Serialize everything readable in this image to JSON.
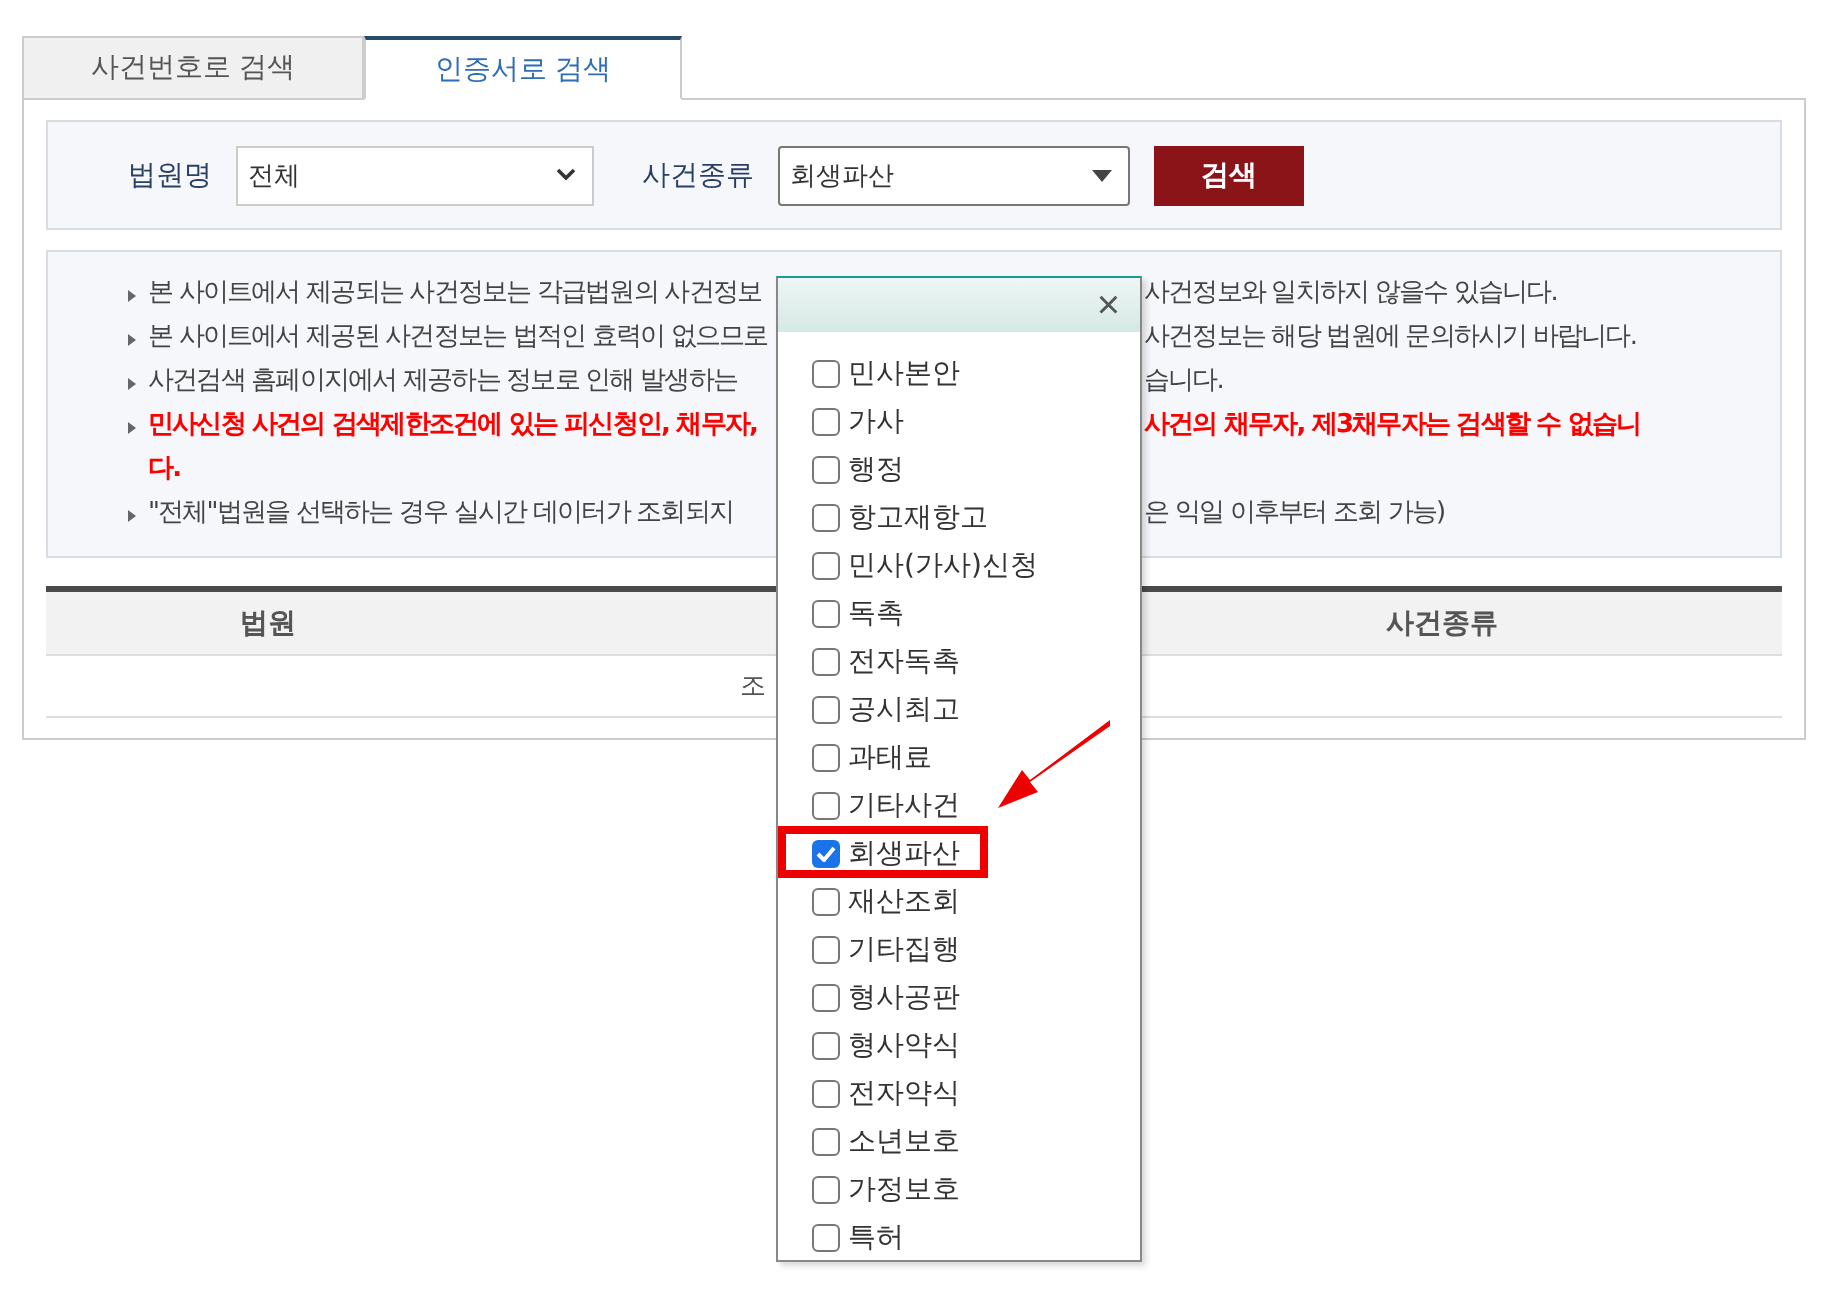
{
  "tabs": [
    {
      "label": "사건번호로 검색",
      "selected": false
    },
    {
      "label": "인증서로 검색",
      "selected": true
    }
  ],
  "search": {
    "court_label": "법원명",
    "court_value": "전체",
    "type_label": "사건종류",
    "type_value": "회생파산",
    "button": "검색"
  },
  "notices": [
    {
      "kind": "normal",
      "left": "본 사이트에서 제공되는 사건정보는 각급법원의 사건정보",
      "right": "사건정보와 일치하지 않을수 있습니다."
    },
    {
      "kind": "normal",
      "left": "본 사이트에서 제공된 사건정보는 법적인 효력이 없으므로",
      "right": "사건정보는 해당 법원에 문의하시기 바랍니다."
    },
    {
      "kind": "normal",
      "left": "사건검색 홈페이지에서 제공하는 정보로 인해 발생하는",
      "right": "습니다."
    },
    {
      "kind": "warning",
      "left": "민사신청 사건의 검색제한조건에 있는 피신청인, 채무자,",
      "right": "사건의 채무자, 제3채무자는 검색할 수 없습니",
      "tail": "다."
    },
    {
      "kind": "normal",
      "left": "\"전체\"법원을 선택하는 경우 실시간 데이터가 조회되지",
      "right": "은 익일 이후부터 조회 가능)"
    }
  ],
  "table": {
    "column_1": "법원",
    "column_3": "사건종류",
    "message": "조"
  },
  "popup": {
    "close": "×",
    "items": [
      {
        "label": "민사본안",
        "checked": false
      },
      {
        "label": "가사",
        "checked": false
      },
      {
        "label": "행정",
        "checked": false
      },
      {
        "label": "항고재항고",
        "checked": false
      },
      {
        "label": "민사(가사)신청",
        "checked": false
      },
      {
        "label": "독촉",
        "checked": false
      },
      {
        "label": "전자독촉",
        "checked": false
      },
      {
        "label": "공시최고",
        "checked": false
      },
      {
        "label": "과태료",
        "checked": false
      },
      {
        "label": "기타사건",
        "checked": false
      },
      {
        "label": "회생파산",
        "checked": true
      },
      {
        "label": "재산조회",
        "checked": false
      },
      {
        "label": "기타집행",
        "checked": false
      },
      {
        "label": "형사공판",
        "checked": false
      },
      {
        "label": "형사약식",
        "checked": false
      },
      {
        "label": "전자약식",
        "checked": false
      },
      {
        "label": "소년보호",
        "checked": false
      },
      {
        "label": "가정보호",
        "checked": false
      },
      {
        "label": "특허",
        "checked": false
      }
    ]
  }
}
